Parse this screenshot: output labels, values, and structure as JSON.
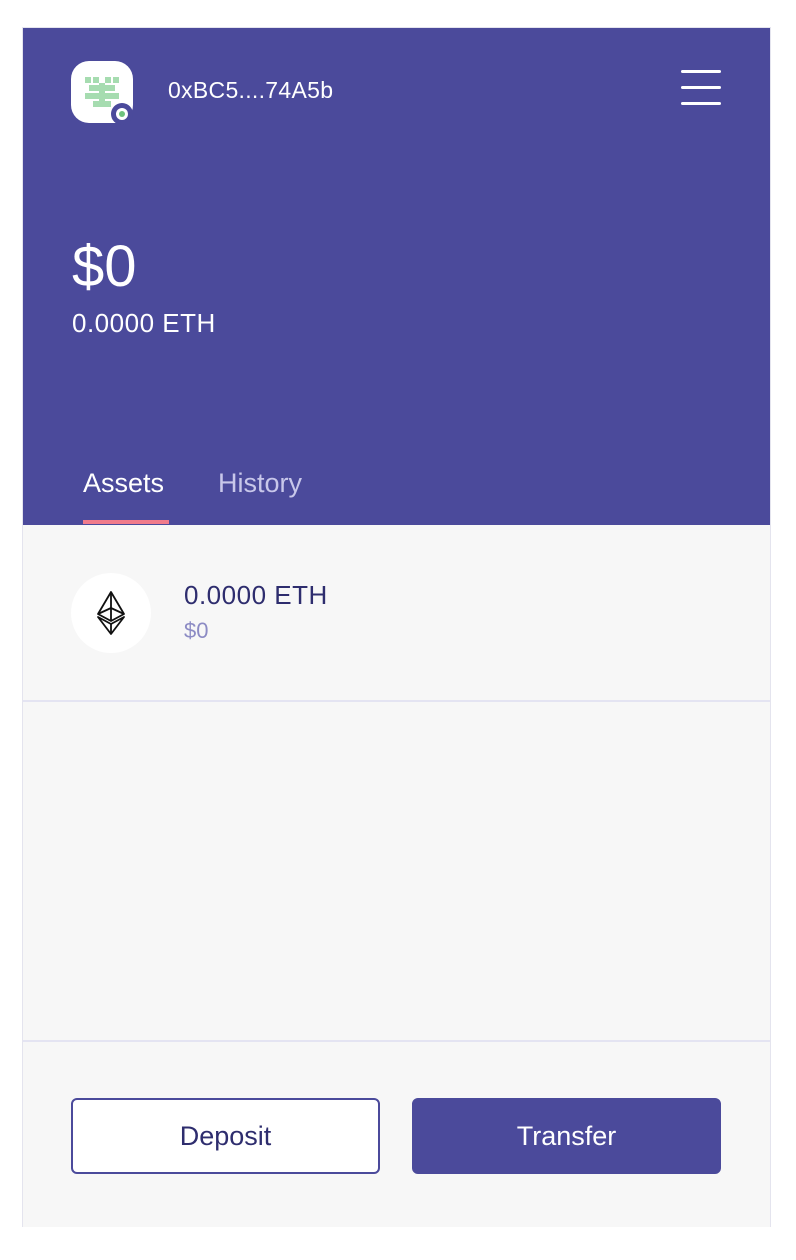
{
  "header": {
    "address": "0xBC5....74A5b",
    "avatar_icon": "identicon-avatar-icon",
    "status": "connected",
    "menu_icon": "hamburger-menu-icon",
    "background_color": "#4b4a9b"
  },
  "balance": {
    "usd": "$0",
    "eth": "0.0000 ETH"
  },
  "tabs": [
    {
      "label": "Assets",
      "active": true
    },
    {
      "label": "History",
      "active": false
    }
  ],
  "assets": [
    {
      "icon": "ethereum-icon",
      "amount": "0.0000 ETH",
      "value": "$0"
    }
  ],
  "actions": {
    "deposit_label": "Deposit",
    "transfer_label": "Transfer"
  },
  "colors": {
    "primary": "#4b4a9b",
    "tab_indicator": "#f07b8b",
    "avatar_pattern": "#a6dcb0",
    "status_dot": "#6fc27d"
  }
}
